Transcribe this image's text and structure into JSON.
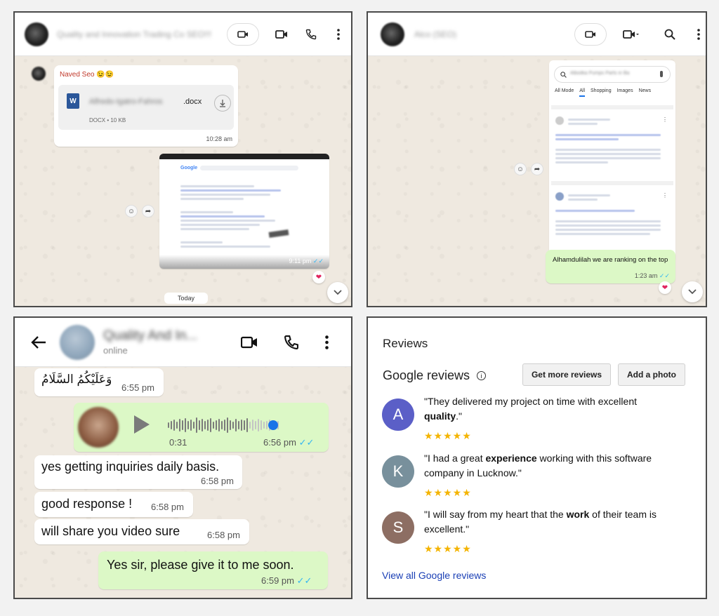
{
  "panel1": {
    "contact_name": "Quality and Innovation Trading Co SEO!!!",
    "sender_name": "Naved Seo 😉😉",
    "doc": {
      "name_blurred": "Alfredo-Igatro-Fahros",
      "ext": ".docx",
      "meta": "DOCX • 10 KB",
      "time": "10:28 am"
    },
    "screenshot_time": "9:11 pm",
    "screenshot_brand": "Google",
    "date_chip": "Today"
  },
  "panel2": {
    "contact_name": "Alco (SEO)",
    "search_query": "Alboilka Pumps Parts in Ba",
    "tabs": [
      "All Mode",
      "All",
      "Shopping",
      "Images",
      "News"
    ],
    "message": "Alhamdulilah we are ranking on the top",
    "message_time": "1:23 am"
  },
  "panel3": {
    "contact_name": "Quality And In...",
    "status": "online",
    "messages": [
      {
        "text": "وَعَلَيْكُمُ السَّلَامُ",
        "time": "6:55 pm"
      },
      {
        "voice_duration": "0:31",
        "time": "6:56 pm"
      },
      {
        "text": "yes getting inquiries daily basis.",
        "time": "6:58 pm"
      },
      {
        "text": "good response !",
        "time": "6:58 pm"
      },
      {
        "text": "will share you video sure",
        "time": "6:58 pm"
      },
      {
        "text": "Yes sir, please give it to me soon.",
        "time": "6:59 pm"
      }
    ]
  },
  "panel4": {
    "heading": "Reviews",
    "subheading": "Google reviews",
    "buttons": {
      "get_more": "Get more reviews",
      "add_photo": "Add a photo"
    },
    "reviews": [
      {
        "initial": "A",
        "color": "#5b5fc7",
        "pre": "\"They delivered my project on time with excellent ",
        "bold": "quality",
        "post": ".\"",
        "stars": "★★★★★"
      },
      {
        "initial": "K",
        "color": "#78909c",
        "pre": "\"I had a great ",
        "bold": "experience",
        "post": " working with this software company in Lucknow.\"",
        "stars": "★★★★★"
      },
      {
        "initial": "S",
        "color": "#8d6e63",
        "pre": "\"I will say from my heart that the ",
        "bold": "work",
        "post": " of their team is excellent.\"",
        "stars": "★★★★★"
      }
    ],
    "view_all": "View all Google reviews"
  }
}
